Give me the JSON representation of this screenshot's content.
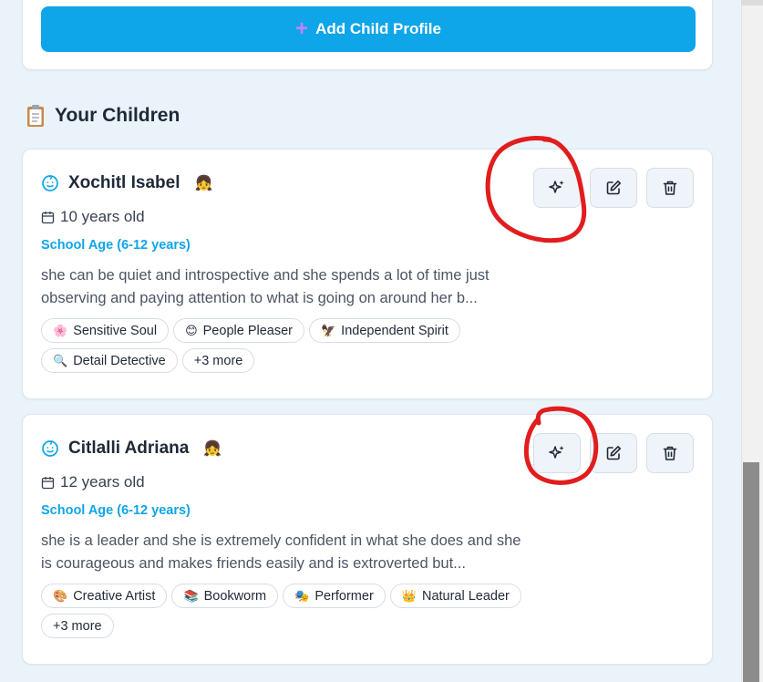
{
  "add_button": {
    "label": "Add Child Profile",
    "icon": "plus-icon"
  },
  "section": {
    "title": "Your Children",
    "icon": "clipboard-icon"
  },
  "children": [
    {
      "name": "Xochitl Isabel",
      "emoji": "👧",
      "age": "10 years old",
      "age_group": "School Age (6-12 years)",
      "description": "she can be quiet and introspective and she spends a lot of time just observing and paying attention to what is going on around her b...",
      "tags": [
        {
          "emoji": "🌸",
          "label": "Sensitive Soul"
        },
        {
          "emoji": "😊",
          "label": "People Pleaser"
        },
        {
          "emoji": "🦅",
          "label": "Independent Spirit"
        },
        {
          "emoji": "🔍",
          "label": "Detail Detective"
        }
      ],
      "more": "+3 more"
    },
    {
      "name": "Citlalli Adriana",
      "emoji": "👧",
      "age": "12 years old",
      "age_group": "School Age (6-12 years)",
      "description": "she is a leader and she is extremely confident in what she does and she is courageous and makes friends easily and is extroverted but...",
      "tags": [
        {
          "emoji": "🎨",
          "label": "Creative Artist"
        },
        {
          "emoji": "📚",
          "label": "Bookworm"
        },
        {
          "emoji": "🎭",
          "label": "Performer"
        },
        {
          "emoji": "👑",
          "label": "Natural Leader"
        }
      ],
      "more": "+3 more"
    }
  ],
  "colors": {
    "accent": "#0ea5e9",
    "annotation": "#e11d1d",
    "background": "#eaf3fa"
  }
}
